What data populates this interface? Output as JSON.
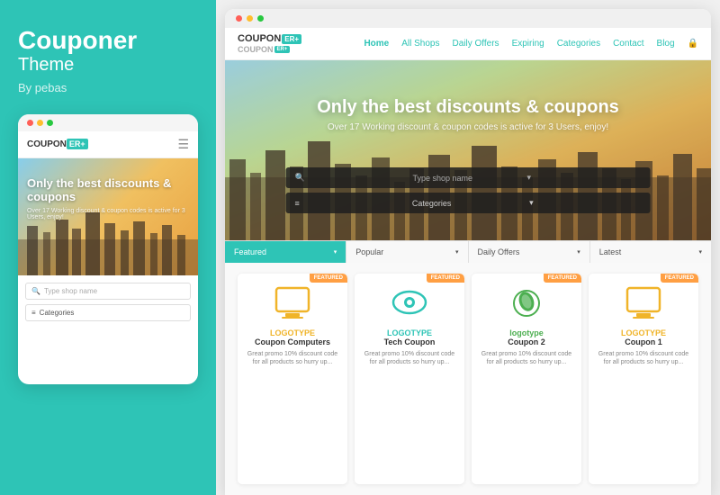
{
  "leftPanel": {
    "brandTitle": "Couponer",
    "brandSubtitle": "Theme",
    "brandAuthor": "By pebas",
    "mobileMockup": {
      "heroTitle": "Only the best discounts & coupons",
      "heroSubtext": "Over 17 Working discount & coupon codes is active for 3 Users, enjoy!",
      "searchPlaceholder": "Type shop name",
      "categoriesLabel": "Categories"
    }
  },
  "rightPanel": {
    "desktopMockup": {
      "navLinks": [
        "Home",
        "All Shops",
        "Daily Offers",
        "Expiring",
        "Categories",
        "Contact",
        "Blog"
      ],
      "heroTitle": "Only the best discounts & coupons",
      "heroSubtext": "Over 17 Working discount & coupon codes is active for 3 Users, enjoy!",
      "searchPlaceholder": "Type shop name",
      "categoriesLabel": "Categories",
      "filterItems": [
        "Featured",
        "Popular",
        "Daily Offers",
        "Latest"
      ],
      "cards": [
        {
          "logoColor": "yellow",
          "logoText": "LOGOTYPE",
          "title": "Coupon Computers",
          "desc": "Great promo 10% discount code for all products so hurry up...",
          "featured": true
        },
        {
          "logoColor": "teal",
          "logoText": "LOGOTYPE",
          "title": "Tech Coupon",
          "desc": "Great promo 10% discount code for all products so hurry up...",
          "featured": true
        },
        {
          "logoColor": "green",
          "logoText": "logotype",
          "title": "Coupon 2",
          "desc": "Great promo 10% discount code for all products so hurry up...",
          "featured": true
        },
        {
          "logoColor": "yellow",
          "logoText": "LOGOTYPE",
          "title": "Coupon 1",
          "desc": "Great promo 10% discount code for all products so hurry up...",
          "featured": true
        }
      ],
      "featuredBadgeLabel": "FEATURED"
    }
  },
  "couponText": "COUPON",
  "erBadge": "ER+"
}
